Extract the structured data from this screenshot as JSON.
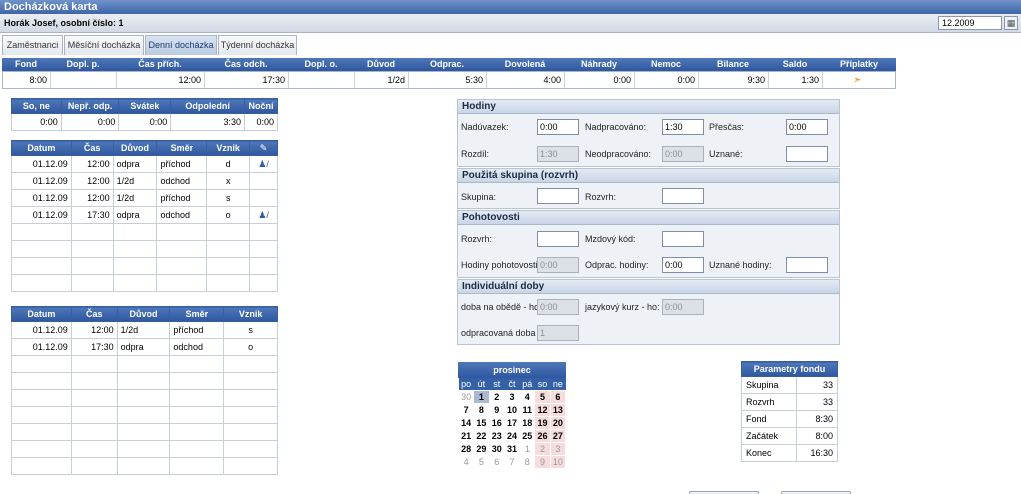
{
  "window": {
    "title": "Docházková karta"
  },
  "user": {
    "name": "Horák Josef, osobní číslo: 1",
    "period": "12.2009",
    "calendar_icon": "calendar-icon"
  },
  "tabs": [
    {
      "label": "Zaměstnanci"
    },
    {
      "label": "Měsíční docházka"
    },
    {
      "label": "Denní docházka"
    },
    {
      "label": "Týdenní docházka"
    }
  ],
  "summary": {
    "headers": [
      "Fond",
      "Dopl. p.",
      "Čas přích.",
      "Čas odch.",
      "Dopl. o.",
      "Důvod",
      "Odprac.",
      "Dovolená",
      "Náhrady",
      "Nemoc",
      "Bilance",
      "Saldo",
      "Příplatky"
    ],
    "values": [
      "8:00",
      "",
      "12:00",
      "17:30",
      "",
      "1/2d",
      "5:30",
      "4:00",
      "0:00",
      "0:00",
      "9:30",
      "1:30",
      ""
    ]
  },
  "special": {
    "headers": [
      "So, ne",
      "Nepř. odp.",
      "Svátek",
      "Odpolední",
      "Noční"
    ],
    "values": [
      "0:00",
      "0:00",
      "0:00",
      "3:30",
      "0:00"
    ]
  },
  "entries": {
    "headers": [
      "Datum",
      "Čas",
      "Důvod",
      "Směr",
      "Vznik"
    ],
    "rows": [
      [
        "01.12.09",
        "12:00",
        "odpra",
        "příchod",
        "d"
      ],
      [
        "01.12.09",
        "12:00",
        "1/2d",
        "odchod",
        "x"
      ],
      [
        "01.12.09",
        "12:00",
        "1/2d",
        "příchod",
        "s"
      ],
      [
        "01.12.09",
        "17:30",
        "odpra",
        "odchod",
        "o"
      ]
    ]
  },
  "entries2": {
    "headers": [
      "Datum",
      "Čas",
      "Důvod",
      "Směr",
      "Vznik"
    ],
    "rows": [
      [
        "01.12.09",
        "12:00",
        "1/2d",
        "příchod",
        "s"
      ],
      [
        "01.12.09",
        "17:30",
        "odpra",
        "odchod",
        "o"
      ]
    ]
  },
  "hodiny": {
    "title": "Hodiny",
    "naduvazek_label": "Nadúvazek:",
    "naduvazek": "0:00",
    "nadpracovano_label": "Nadpracováno:",
    "nadpracovano": "1:30",
    "prescas_label": "Přesčas:",
    "prescas": "0:00",
    "rozdil_label": "Rozdíl:",
    "rozdil": "1:30",
    "neodpracovano_label": "Neodpracováno:",
    "neodpracovano": "0:00",
    "uznane_label": "Uznané:",
    "uznane": ""
  },
  "skupina": {
    "title": "Použitá skupina (rozvrh)",
    "skupina_label": "Skupina:",
    "skupina": "",
    "rozvrh_label": "Rozvrh:",
    "rozvrh": ""
  },
  "pohotovosti": {
    "title": "Pohotovosti",
    "rozvrh_label": "Rozvrh:",
    "rozvrh": "",
    "mzdovy_label": "Mzdový kód:",
    "mzdovy": "",
    "hodiny_label": "Hodiny pohotovosti:",
    "hodiny": "0:00",
    "odprac_label": "Odprac. hodiny:",
    "odprac": "0:00",
    "uznane_label": "Uznané hodiny:",
    "uznane": ""
  },
  "individualni": {
    "title": "Individuální doby",
    "obed_label": "doba na obědě - ho:",
    "obed": "0:00",
    "kurz_label": "jazykový kurz - ho:",
    "kurz": "0:00",
    "odprac_label": "odpracovaná doba -",
    "odprac": "1"
  },
  "calendar": {
    "month": "prosinec",
    "weekdays": [
      "po",
      "út",
      "st",
      "čt",
      "pá",
      "so",
      "ne"
    ],
    "weeks": [
      [
        "30",
        "1",
        "2",
        "3",
        "4",
        "5",
        "6"
      ],
      [
        "7",
        "8",
        "9",
        "10",
        "11",
        "12",
        "13"
      ],
      [
        "14",
        "15",
        "16",
        "17",
        "18",
        "19",
        "20"
      ],
      [
        "21",
        "22",
        "23",
        "24",
        "25",
        "26",
        "27"
      ],
      [
        "28",
        "29",
        "30",
        "31",
        "1",
        "2",
        "3"
      ],
      [
        "4",
        "5",
        "6",
        "7",
        "8",
        "9",
        "10"
      ]
    ]
  },
  "params": {
    "title": "Parametry fondu",
    "rows": [
      [
        "Skupina",
        "33"
      ],
      [
        "Rozvrh",
        "33"
      ],
      [
        "Fond",
        "8:30"
      ],
      [
        "Začátek",
        "8:00"
      ],
      [
        "Konec",
        "16:30"
      ]
    ]
  }
}
